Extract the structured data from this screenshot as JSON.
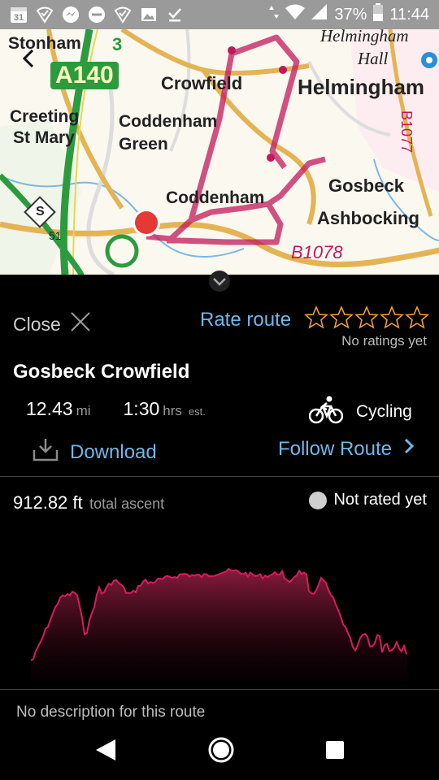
{
  "status_bar": {
    "date_icon_text": "31",
    "battery_percent": "37%",
    "time": "11:44",
    "icons": [
      "calendar-icon",
      "signal-check-icon",
      "messenger-icon",
      "minus-circle-icon",
      "signal-check-icon",
      "image-icon",
      "download-done-icon",
      "data-arrows-icon",
      "wifi-icon",
      "cell-signal-icon",
      "battery-icon"
    ]
  },
  "map": {
    "labels": {
      "stonham": "Stonham",
      "a140": "A140",
      "crowfield": "Crowfield",
      "helmingham": "Helmingham",
      "helmingham_top": "Helmingham",
      "hall": "Hall",
      "creeting": "Creeting",
      "st_mary": "St Mary",
      "coddenham_green_1": "Coddenham",
      "coddenham_green_2": "Green",
      "coddenham": "Coddenham",
      "gosbeck": "Gosbeck",
      "ashbocking": "Ashbocking",
      "b1078": "B1078",
      "b1077": "B1077",
      "num_3": "3",
      "num_51": "51",
      "shield_s": "S"
    },
    "route_color": "#c2185b",
    "marker_color": "#e53935"
  },
  "sheet": {
    "close_label": "Close",
    "rate_label": "Rate route",
    "no_ratings": "No ratings yet",
    "title": "Gosbeck Crowfield",
    "distance_value": "12.43",
    "distance_unit": "mi",
    "time_value": "1:30",
    "time_unit": "hrs",
    "time_est": "est.",
    "activity": "Cycling",
    "download_label": "Download",
    "follow_label": "Follow Route",
    "ascent_value": "912.82 ft",
    "ascent_label": "total ascent",
    "rated_status": "Not rated yet",
    "description": "No description for this route",
    "accent_color": "#6fb7e9",
    "star_color": "#f0a030",
    "star_rating": 0,
    "star_count": 5
  },
  "nav": {
    "icons": [
      "back-icon",
      "home-icon",
      "recents-icon"
    ]
  }
}
